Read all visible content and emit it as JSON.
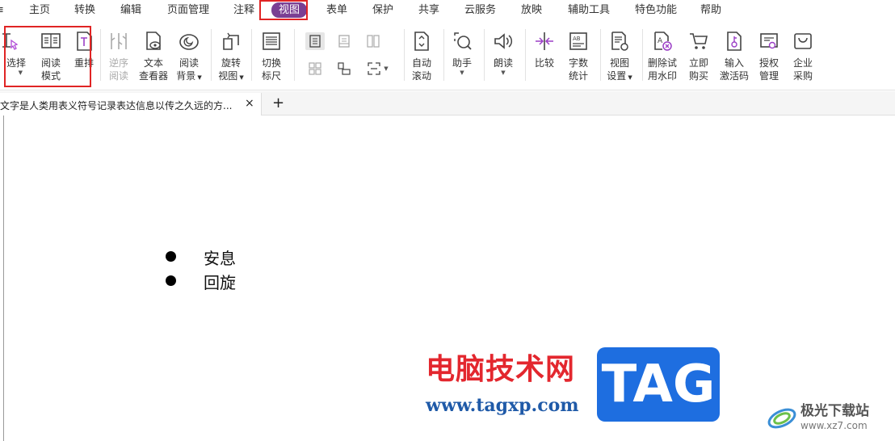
{
  "menu": {
    "items": [
      "主页",
      "转换",
      "编辑",
      "页面管理",
      "注释",
      "视图",
      "表单",
      "保护",
      "共享",
      "云服务",
      "放映",
      "辅助工具",
      "特色功能",
      "帮助"
    ],
    "active": "视图"
  },
  "ribbon": {
    "select": {
      "label": "选择",
      "icon": "text-select-icon"
    },
    "read_mode": {
      "line1": "阅读",
      "line2": "模式",
      "icon": "read-mode-icon"
    },
    "reflow": {
      "label": "重排",
      "icon": "reflow-icon"
    },
    "reverse_read": {
      "line1": "逆序",
      "line2": "阅读",
      "icon": "reverse-read-icon"
    },
    "text_viewer": {
      "line1": "文本",
      "line2": "查看器",
      "icon": "text-viewer-icon"
    },
    "read_bg": {
      "line1": "阅读",
      "line2": "背景",
      "icon": "read-background-icon"
    },
    "rotate_view": {
      "line1": "旋转",
      "line2": "视图",
      "icon": "rotate-view-icon"
    },
    "ruler": {
      "line1": "切换",
      "line2": "标尺",
      "icon": "ruler-icon"
    },
    "auto_scroll": {
      "line1": "自动",
      "line2": "滚动",
      "icon": "auto-scroll-icon"
    },
    "assistant": {
      "label": "助手",
      "icon": "assistant-icon"
    },
    "read_aloud": {
      "label": "朗读",
      "icon": "speaker-icon"
    },
    "compare": {
      "label": "比较",
      "icon": "compare-icon"
    },
    "word_count": {
      "line1": "字数",
      "line2": "统计",
      "icon": "word-count-icon"
    },
    "view_settings": {
      "line1": "视图",
      "line2": "设置",
      "icon": "view-settings-icon"
    },
    "remove_watermark": {
      "line1": "删除试",
      "line2": "用水印",
      "icon": "remove-watermark-icon"
    },
    "buy_now": {
      "line1": "立即",
      "line2": "购买",
      "icon": "cart-icon"
    },
    "activation": {
      "line1": "输入",
      "line2": "激活码",
      "icon": "activation-key-icon"
    },
    "license": {
      "line1": "授权",
      "line2": "管理",
      "icon": "license-icon"
    },
    "enterprise": {
      "line1": "企业",
      "line2": "采购",
      "icon": "enterprise-bag-icon"
    }
  },
  "tabs": {
    "document_title": "文字是人类用表义符号记录表达信息以传之久远的方...",
    "close": "×",
    "add": "+"
  },
  "document": {
    "bullets": [
      "安息",
      "回旋"
    ]
  },
  "watermark": {
    "cn_text": "电脑技术网",
    "url": "www.tagxp.com",
    "tag": "TAG",
    "site_name": "极光下载站",
    "site_url": "www.xz7.com"
  },
  "colors": {
    "active_tab_bg": "#7a3f93",
    "highlight_box": "#e02424",
    "watermark_red": "#e3272e",
    "watermark_blue": "#1e6ee0"
  }
}
